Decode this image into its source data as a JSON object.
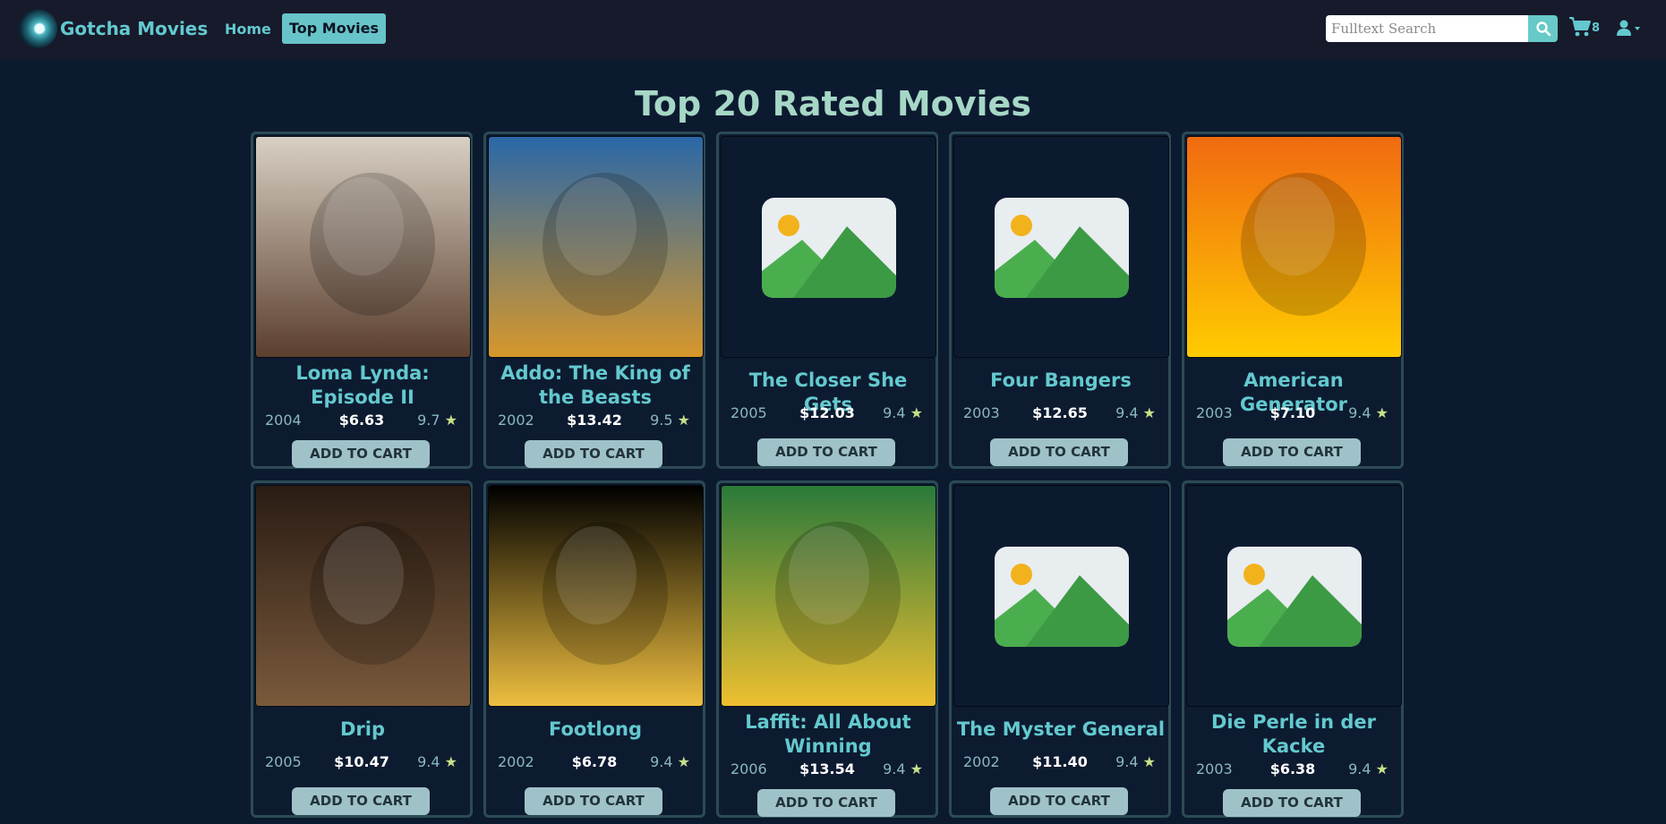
{
  "nav": {
    "brand": "Gotcha Movies",
    "home": "Home",
    "top_movies": "Top Movies",
    "search_placeholder": "Fulltext Search",
    "cart_count": "8"
  },
  "page_title": "Top 20 Rated Movies",
  "add_to_cart_label": "ADD TO CART",
  "movies": [
    {
      "title": "Loma Lynda: Episode II",
      "year": "2004",
      "price": "$6.63",
      "rating": "9.7",
      "poster": "photo",
      "poster_colors": [
        "#d8d0c4",
        "#5a3d2c"
      ],
      "poster_icon": "poster-photo"
    },
    {
      "title": "Addo: The King of the Beasts",
      "year": "2002",
      "price": "$13.42",
      "rating": "9.5",
      "poster": "photo",
      "poster_colors": [
        "#2a68a8",
        "#d8982a"
      ],
      "poster_icon": "poster-photo"
    },
    {
      "title": "The Closer She Gets",
      "year": "2005",
      "price": "$12.03",
      "rating": "9.4",
      "poster": "placeholder",
      "poster_icon": "image-placeholder-icon"
    },
    {
      "title": "Four Bangers",
      "year": "2003",
      "price": "$12.65",
      "rating": "9.4",
      "poster": "placeholder",
      "poster_icon": "image-placeholder-icon"
    },
    {
      "title": "American Generator",
      "year": "2003",
      "price": "$7.10",
      "rating": "9.4",
      "poster": "photo",
      "poster_colors": [
        "#f06a10",
        "#ffcc00"
      ],
      "poster_icon": "poster-photo"
    },
    {
      "title": "Drip",
      "year": "2005",
      "price": "$10.47",
      "rating": "9.4",
      "poster": "photo",
      "poster_colors": [
        "#2a1c14",
        "#7a5a3c"
      ],
      "poster_icon": "poster-photo"
    },
    {
      "title": "Footlong",
      "year": "2002",
      "price": "$6.78",
      "rating": "9.4",
      "poster": "photo",
      "poster_colors": [
        "#000000",
        "#f0c040"
      ],
      "poster_icon": "poster-photo"
    },
    {
      "title": "Laffit: All About Winning",
      "year": "2006",
      "price": "$13.54",
      "rating": "9.4",
      "poster": "photo",
      "poster_colors": [
        "#2a7a3a",
        "#f0c030"
      ],
      "poster_icon": "poster-photo"
    },
    {
      "title": "The Myster General",
      "year": "2002",
      "price": "$11.40",
      "rating": "9.4",
      "poster": "placeholder",
      "poster_icon": "image-placeholder-icon"
    },
    {
      "title": "Die Perle in der Kacke",
      "year": "2003",
      "price": "$6.38",
      "rating": "9.4",
      "poster": "placeholder",
      "poster_icon": "image-placeholder-icon"
    }
  ]
}
